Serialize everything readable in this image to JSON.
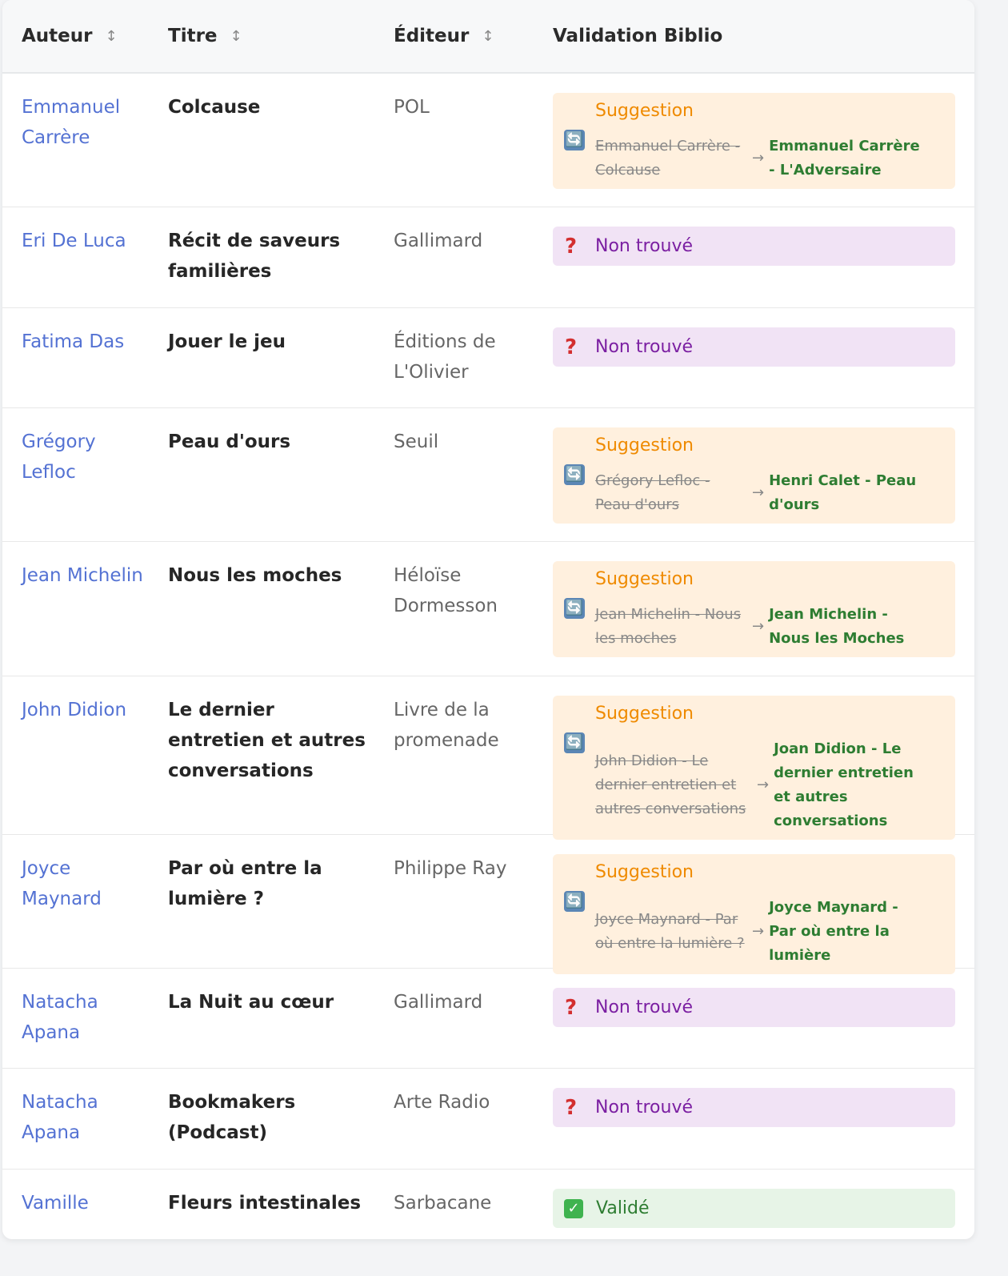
{
  "headers": {
    "author": "Auteur",
    "title": "Titre",
    "publisher": "Éditeur",
    "validation": "Validation Biblio",
    "sort_glyph": "↕"
  },
  "icons": {
    "sync": "🔄",
    "question": "?",
    "check": "✓",
    "arrow": "→"
  },
  "colors": {
    "author_link": "#5472d3",
    "suggestion_bg": "#fff0de",
    "suggestion_label": "#ef8a00",
    "not_found_bg": "#f1e3f5",
    "not_found_text": "#7b1fa2",
    "valid_bg": "#e7f4e7",
    "valid_text": "#2e7d32"
  },
  "rows": [
    {
      "author": "Emmanuel Carrère",
      "title": "Colcause",
      "publisher": "POL",
      "status": "suggestion",
      "label": "Suggestion",
      "old": "Emmanuel Carrère - Colcause",
      "new": "Emmanuel Carrère - L'Adversaire"
    },
    {
      "author": "Eri De Luca",
      "title": "Récit de saveurs familières",
      "publisher": "Gallimard",
      "status": "not_found",
      "label": "Non trouvé"
    },
    {
      "author": "Fatima Das",
      "title": "Jouer le jeu",
      "publisher": "Éditions de L'Olivier",
      "status": "not_found",
      "label": "Non trouvé"
    },
    {
      "author": "Grégory Lefloc",
      "title": "Peau d'ours",
      "publisher": "Seuil",
      "status": "suggestion",
      "label": "Suggestion",
      "old": "Grégory Lefloc - Peau d'ours",
      "new": "Henri Calet - Peau d'ours"
    },
    {
      "author": "Jean Michelin",
      "title": "Nous les moches",
      "publisher": "Héloïse Dormesson",
      "status": "suggestion",
      "label": "Suggestion",
      "old": "Jean Michelin - Nous les moches",
      "new": "Jean Michelin - Nous les Moches"
    },
    {
      "author": "John Didion",
      "title": "Le dernier entretien et autres conversations",
      "publisher": "Livre de la promenade",
      "status": "suggestion",
      "label": "Suggestion",
      "old": "John Didion - Le dernier entretien et autres conversations",
      "new": "Joan Didion - Le dernier entretien et autres conversations"
    },
    {
      "author": "Joyce Maynard",
      "title": "Par où entre la lumière ?",
      "publisher": "Philippe Ray",
      "status": "suggestion",
      "label": "Suggestion",
      "old": "Joyce Maynard - Par où entre la lumière ?",
      "new": "Joyce Maynard - Par où entre la lumière"
    },
    {
      "author": "Natacha Apana",
      "title": "La Nuit au cœur",
      "publisher": "Gallimard",
      "status": "not_found",
      "label": "Non trouvé"
    },
    {
      "author": "Natacha Apana",
      "title": "Bookmakers (Podcast)",
      "publisher": "Arte Radio",
      "status": "not_found",
      "label": "Non trouvé"
    },
    {
      "author": "Vamille",
      "title": "Fleurs intestinales",
      "publisher": "Sarbacane",
      "status": "valid",
      "label": "Validé"
    }
  ]
}
